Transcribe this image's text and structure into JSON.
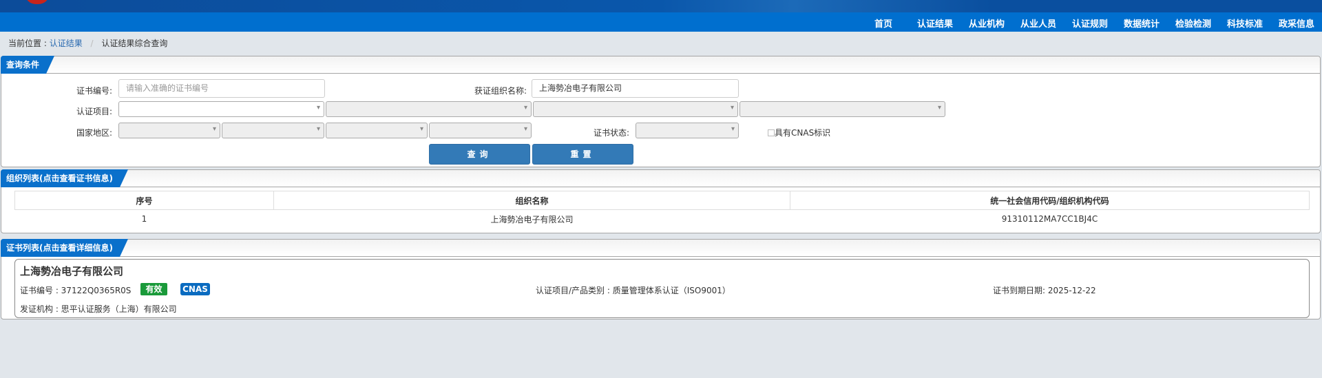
{
  "nav": [
    "首页",
    "认证结果",
    "从业机构",
    "从业人员",
    "认证规则",
    "数据统计",
    "检验检测",
    "科技标准",
    "政采信息"
  ],
  "breadcrumb": {
    "prefix": "当前位置 :",
    "link": "认证结果",
    "separator": "/",
    "current": "认证结果综合查询"
  },
  "query": {
    "title": "查询条件",
    "cert_no_label": "证书编号:",
    "cert_no_placeholder": "请输入准确的证书编号",
    "org_label": "获证组织名称:",
    "org_value": "上海勢冶电子有限公司",
    "project_label": "认证项目:",
    "region_label": "国家地区:",
    "status_label": "证书状态:",
    "cnas_label": "具有CNAS标识",
    "search": "查询",
    "reset": "重置"
  },
  "org_list": {
    "title": "组织列表(点击查看证书信息)",
    "headers": [
      "序号",
      "组织名称",
      "统一社会信用代码/组织机构代码"
    ],
    "rows": [
      [
        "1",
        "上海勢冶电子有限公司",
        "91310112MA7CC1BJ4C"
      ]
    ]
  },
  "cert_list": {
    "title": "证书列表(点击查看详细信息)",
    "company": "上海勢冶电子有限公司",
    "cert_no": "证书编号 : 37122Q0365R0S",
    "status_badge": "有效",
    "cnas_badge": "CNAS",
    "project": "认证项目/产品类别 : 质量管理体系认证（ISO9001）",
    "expiry": "证书到期日期: 2025-12-22",
    "issuer": "发证机构 : 思平认证服务（上海）有限公司"
  },
  "colors": {
    "nav": "#006fcf",
    "tag": "#0a70cb",
    "button": "#337ab7",
    "valid": "#1a9a3a",
    "cnas": "#0a6bc0"
  }
}
